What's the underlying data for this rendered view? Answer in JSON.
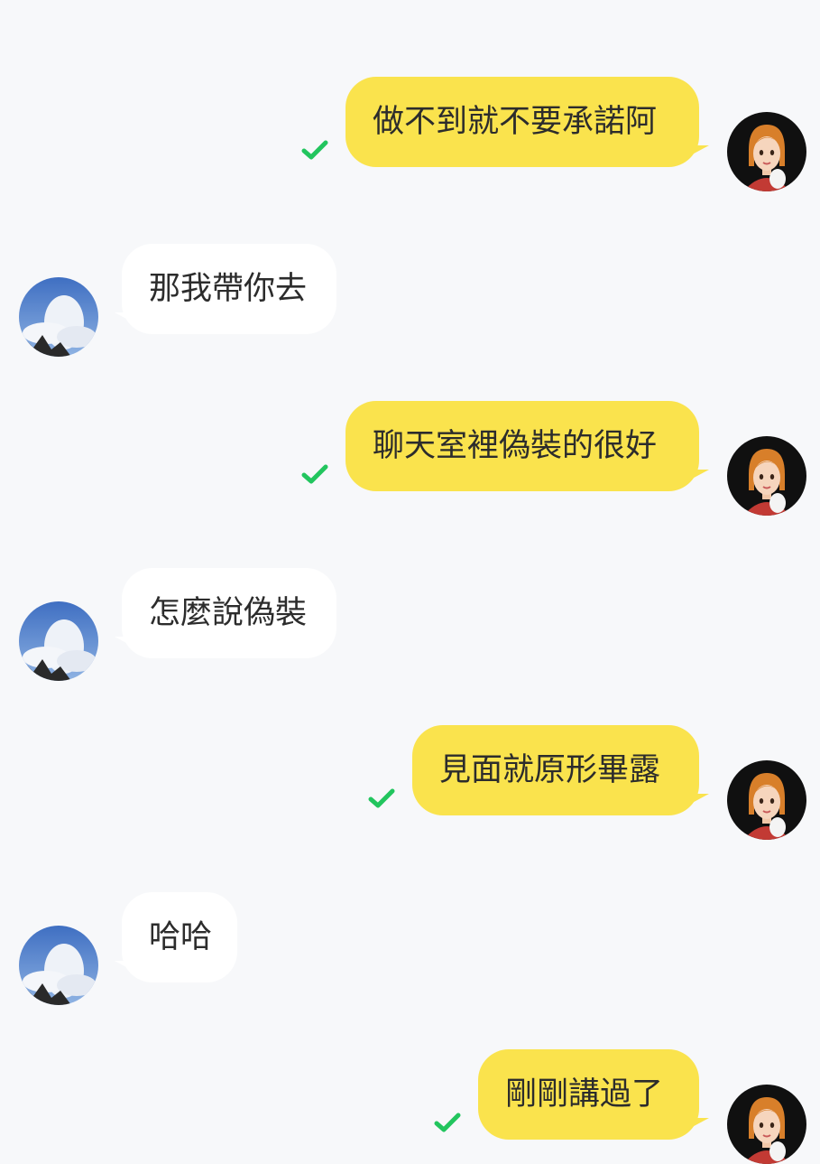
{
  "messages": [
    {
      "sender": "me",
      "text": "做不到就不要承諾阿",
      "status": "read",
      "avatar": "woman-avatar"
    },
    {
      "sender": "them",
      "text": "那我帶你去",
      "avatar": "cloud-avatar"
    },
    {
      "sender": "me",
      "text": "聊天室裡偽裝的很好",
      "status": "read",
      "avatar": "woman-avatar"
    },
    {
      "sender": "them",
      "text": "怎麼說偽裝",
      "avatar": "cloud-avatar"
    },
    {
      "sender": "me",
      "text": "見面就原形畢露",
      "status": "read",
      "avatar": "woman-avatar"
    },
    {
      "sender": "them",
      "text": "哈哈",
      "avatar": "cloud-avatar"
    },
    {
      "sender": "me",
      "text": "剛剛講過了",
      "status": "read",
      "avatar": "woman-avatar"
    }
  ],
  "colors": {
    "background": "#f7f8fa",
    "outgoing_bubble": "#fae34d",
    "incoming_bubble": "#ffffff",
    "read_check": "#22c55e"
  }
}
